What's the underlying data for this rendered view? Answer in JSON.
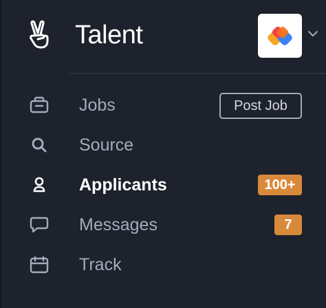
{
  "header": {
    "app_title": "Talent",
    "logo_icon": "victory-hand-icon",
    "company_icon": "company-logo-icon",
    "chevron_icon": "chevron-down-icon"
  },
  "nav": {
    "items": [
      {
        "label": "Jobs",
        "icon": "briefcase-icon",
        "action_label": "Post Job"
      },
      {
        "label": "Source",
        "icon": "search-icon"
      },
      {
        "label": "Applicants",
        "icon": "person-icon",
        "badge": "100+",
        "active": true
      },
      {
        "label": "Messages",
        "icon": "message-icon",
        "badge": "7"
      },
      {
        "label": "Track",
        "icon": "calendar-icon"
      }
    ]
  },
  "colors": {
    "background": "#1d222d",
    "text_primary": "#ffffff",
    "text_muted": "#a4acbb",
    "badge": "#d9893a"
  }
}
